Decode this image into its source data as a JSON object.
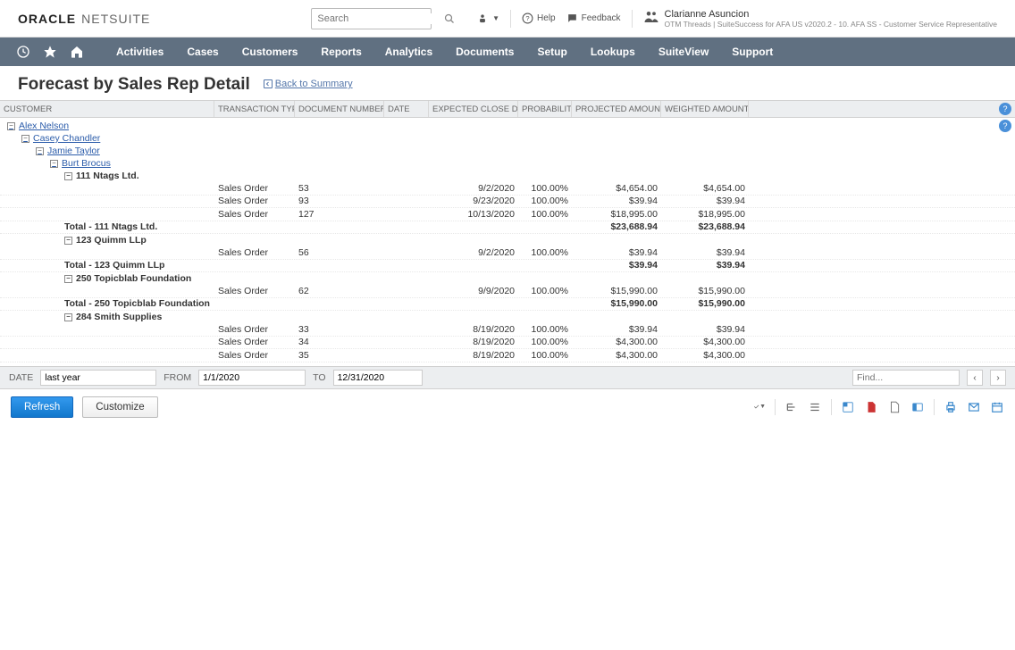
{
  "header": {
    "logo1": "ORACLE",
    "logo2": "NETSUITE",
    "search_placeholder": "Search",
    "help": "Help",
    "feedback": "Feedback",
    "user_name": "Clarianne Asuncion",
    "user_sub": "OTM Threads | SuiteSuccess for AFA US v2020.2 - 10. AFA SS - Customer Service Representative"
  },
  "nav": [
    "Activities",
    "Cases",
    "Customers",
    "Reports",
    "Analytics",
    "Documents",
    "Setup",
    "Lookups",
    "SuiteView",
    "Support"
  ],
  "page": {
    "title": "Forecast by Sales Rep Detail",
    "back": "Back to Summary"
  },
  "columns": {
    "customer": "CUSTOMER",
    "ttype": "TRANSACTION TYPE",
    "docnum": "DOCUMENT NUMBER",
    "date": "DATE",
    "expclose": "EXPECTED CLOSE DATE",
    "prob": "PROBABILITY",
    "proj": "PROJECTED AMOUNT",
    "weight": "WEIGHTED AMOUNT"
  },
  "tree": {
    "l0": "Alex Nelson",
    "l1": "Casey Chandler",
    "l2": "Jamie Taylor",
    "l3": "Burt Brocus",
    "c1": "111 Ntags Ltd.",
    "c1_rows": [
      {
        "ttype": "Sales Order",
        "doc": "53",
        "date": "9/2/2020",
        "prob": "100.00%",
        "proj": "$4,654.00",
        "weight": "$4,654.00"
      },
      {
        "ttype": "Sales Order",
        "doc": "93",
        "date": "9/23/2020",
        "prob": "100.00%",
        "proj": "$39.94",
        "weight": "$39.94"
      },
      {
        "ttype": "Sales Order",
        "doc": "127",
        "date": "10/13/2020",
        "prob": "100.00%",
        "proj": "$18,995.00",
        "weight": "$18,995.00"
      }
    ],
    "c1_total": {
      "label": "Total - 111 Ntags Ltd.",
      "proj": "$23,688.94",
      "weight": "$23,688.94"
    },
    "c2": "123 Quimm LLp",
    "c2_rows": [
      {
        "ttype": "Sales Order",
        "doc": "56",
        "date": "9/2/2020",
        "prob": "100.00%",
        "proj": "$39.94",
        "weight": "$39.94"
      }
    ],
    "c2_total": {
      "label": "Total - 123 Quimm LLp",
      "proj": "$39.94",
      "weight": "$39.94"
    },
    "c3": "250 Topicblab Foundation",
    "c3_rows": [
      {
        "ttype": "Sales Order",
        "doc": "62",
        "date": "9/9/2020",
        "prob": "100.00%",
        "proj": "$15,990.00",
        "weight": "$15,990.00"
      }
    ],
    "c3_total": {
      "label": "Total - 250 Topicblab Foundation",
      "proj": "$15,990.00",
      "weight": "$15,990.00"
    },
    "c4": "284 Smith Supplies",
    "c4_rows": [
      {
        "ttype": "Sales Order",
        "doc": "33",
        "date": "8/19/2020",
        "prob": "100.00%",
        "proj": "$39.94",
        "weight": "$39.94"
      },
      {
        "ttype": "Sales Order",
        "doc": "34",
        "date": "8/19/2020",
        "prob": "100.00%",
        "proj": "$4,300.00",
        "weight": "$4,300.00"
      },
      {
        "ttype": "Sales Order",
        "doc": "35",
        "date": "8/19/2020",
        "prob": "100.00%",
        "proj": "$4,300.00",
        "weight": "$4,300.00"
      }
    ]
  },
  "filter": {
    "date_label": "DATE",
    "date_value": "last year",
    "from_label": "FROM",
    "from_value": "1/1/2020",
    "to_label": "TO",
    "to_value": "12/31/2020",
    "find_placeholder": "Find..."
  },
  "actions": {
    "refresh": "Refresh",
    "customize": "Customize"
  }
}
